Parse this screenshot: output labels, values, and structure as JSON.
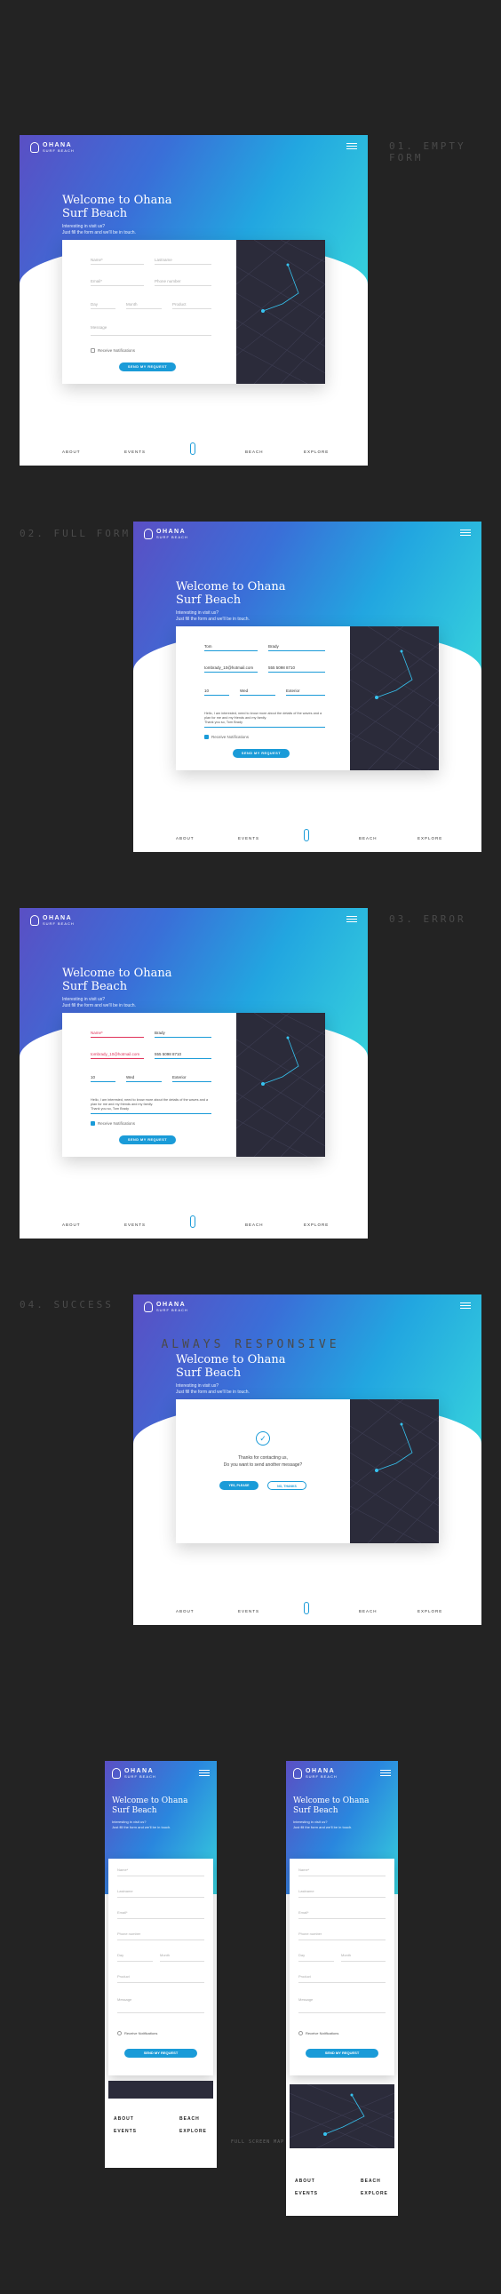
{
  "brand": {
    "name": "OHANA",
    "sub": "SURF BEACH"
  },
  "hero": {
    "title": "Welcome to Ohana Surf Beach",
    "sub_1": "Interesting in visit us?",
    "sub_2": "Just fill the form and we'll be in touch."
  },
  "steps": {
    "s1": "01. EMPTY FORM",
    "s2": "02. FULL FORM",
    "s3": "03. ERROR",
    "s4": "04. SUCCESS"
  },
  "form_empty": {
    "name": "Name*",
    "lastname": "Lastname",
    "email": "Email*",
    "phone": "Phone number",
    "day": "Day",
    "month": "Month",
    "product": "Product",
    "message": "Message",
    "notif": "Receive Notifications",
    "send": "SEND MY REQUEST"
  },
  "form_full": {
    "name": "Tom",
    "lastname": "Brady",
    "email": "tombrady_10@hotmail.com",
    "phone": "555 5098 8710",
    "day": "10",
    "month": "Wed",
    "product": "Exterior",
    "message": "Hello, I am interested, need to know more about the details of the waves and a plan for me and my friends and my family.",
    "message_sign": "Thank you so, Tom Brady"
  },
  "form_error": {
    "name": "Name*",
    "lastname": "Brady",
    "email": "tombrady_10@hotmail.com",
    "phone": "555 5098 8710",
    "day": "10",
    "month": "Wed",
    "product": "Exterior",
    "message": "Hello, I am interested, need to know more about the details of the waves and a plan for me and my friends and my family.",
    "message_sign": "Thank you so, Tom Brady"
  },
  "success": {
    "line1": "Thanks for contacting us,",
    "line2": "Do you want to send another message?",
    "yes": "YES, PLEASE",
    "no": "NO, THANKS"
  },
  "footer": {
    "about": "ABOUT",
    "events": "EVENTS",
    "beach": "BEACH",
    "explore": "EXPLORE"
  },
  "responsive": {
    "title": "ALWAYS RESPONSIVE",
    "connector": "FULL SCREEN MAP"
  },
  "mobile": {
    "name": "Name*",
    "lastname": "Lastname",
    "email": "Email*",
    "phone": "Phone number",
    "day": "Day",
    "month": "Month",
    "product": "Product",
    "message": "Message",
    "notif": "Receive Notifications",
    "send": "SEND MY REQUEST"
  },
  "colors": {
    "accent": "#1a9bd8",
    "error": "#e0325a",
    "bg": "#232323",
    "map": "#2b2b3a"
  }
}
